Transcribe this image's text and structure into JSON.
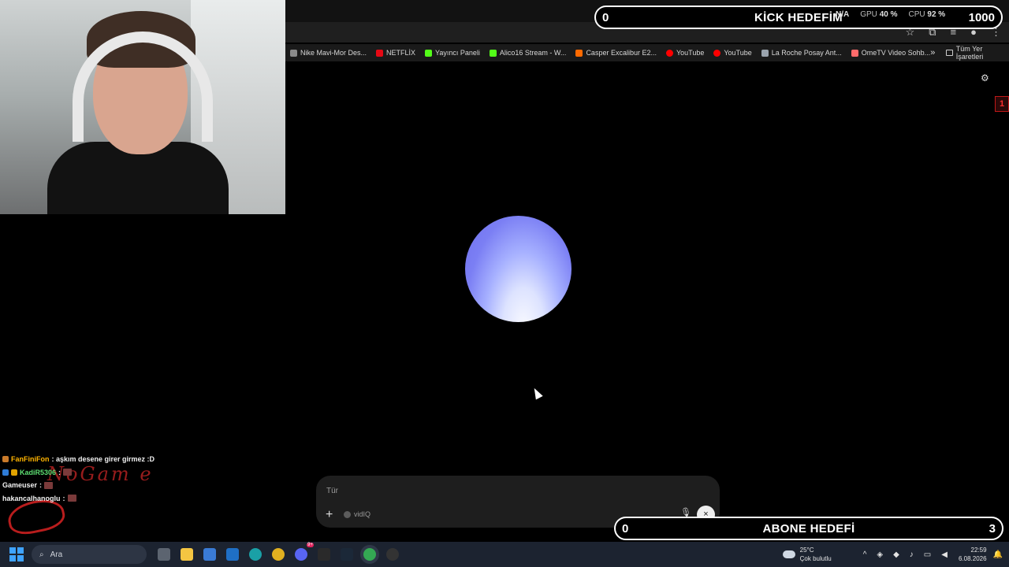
{
  "browser": {
    "bookmarks": [
      {
        "label": "Nike Mavi-Mor Des...",
        "color": "#8a8a8a"
      },
      {
        "label": "NETFLİX",
        "color": "#e50914"
      },
      {
        "label": "Yayıncı Paneli",
        "color": "#53fc18"
      },
      {
        "label": "Alico16 Stream - W...",
        "color": "#53fc18"
      },
      {
        "label": "Casper Excalibur E2...",
        "color": "#ff6a00"
      },
      {
        "label": "YouTube",
        "color": "#ff0000"
      },
      {
        "label": "YouTube",
        "color": "#ff0000"
      },
      {
        "label": "La Roche Posay Ant...",
        "color": "#9aa3ad"
      },
      {
        "label": "OmeTV Video Sohb...",
        "color": "#ff6b6b"
      }
    ],
    "more_glyph": "»",
    "all_bookmarks_label": "Tüm Yer İşaretleri"
  },
  "overlay": {
    "kick_goal": {
      "current": "0",
      "title": "KİCK HEDEFİM",
      "target": "1000"
    },
    "sub_goal": {
      "current": "0",
      "title": "ABONE HEDEFİ",
      "target": "3"
    },
    "stats": {
      "na_value": "N/A",
      "gpu_label": "GPU",
      "gpu_value": "40 %",
      "cpu_label": "CPU",
      "cpu_value": "92 %"
    },
    "side_badge": "1"
  },
  "assistant": {
    "orb_color": "#7b7ff4",
    "composer": {
      "placeholder": "Tür",
      "plus": "+",
      "tool_label": "vidIQ",
      "close": "×"
    }
  },
  "chat": {
    "messages": [
      {
        "user": "FanFiniFon",
        "text": ": aşkım desene girer girmez :D"
      },
      {
        "user": "KadiR5306",
        "text": ":"
      },
      {
        "user": "Gameuser",
        "text": ":"
      },
      {
        "user": "hakancalhanoglu",
        "text": ":"
      }
    ],
    "watermark": "NoGam e"
  },
  "taskbar": {
    "search_label": "Ara",
    "weather_temp": "25°C",
    "weather_desc": "Çok bulutlu",
    "time": "22:59",
    "date": "6.08.2026",
    "discord_badge": "9+"
  }
}
